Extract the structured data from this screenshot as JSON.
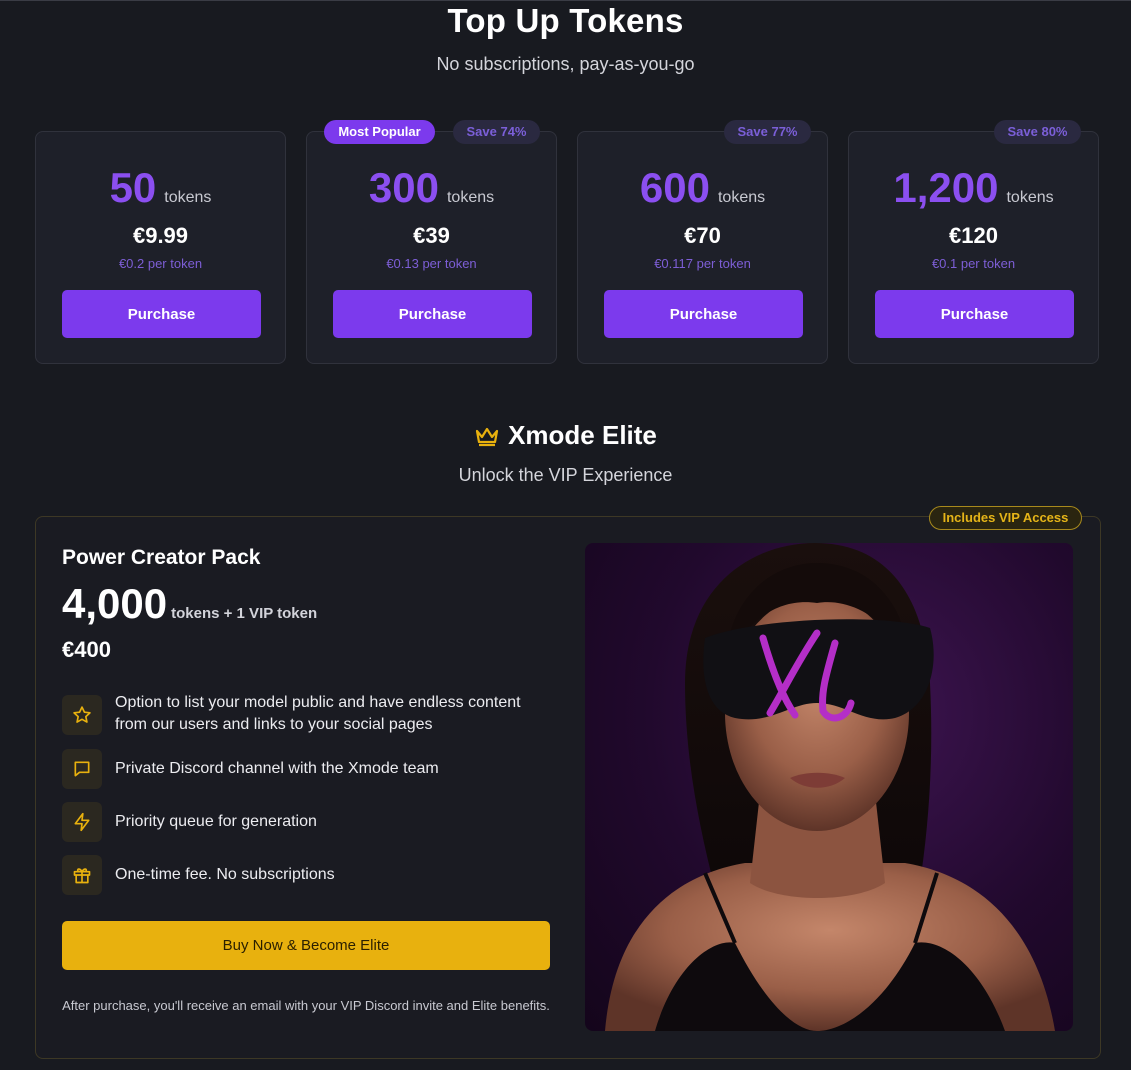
{
  "tokens_section": {
    "title": "Top Up Tokens",
    "subtitle": "No subscriptions, pay-as-you-go",
    "most_popular_label": "Most Popular",
    "packages": [
      {
        "amount": "50",
        "unit": "tokens",
        "price": "€9.99",
        "per_token": "€0.2 per token",
        "save": "",
        "button": "Purchase"
      },
      {
        "amount": "300",
        "unit": "tokens",
        "price": "€39",
        "per_token": "€0.13 per token",
        "save": "Save 74%",
        "button": "Purchase"
      },
      {
        "amount": "600",
        "unit": "tokens",
        "price": "€70",
        "per_token": "€0.117 per token",
        "save": "Save 77%",
        "button": "Purchase"
      },
      {
        "amount": "1,200",
        "unit": "tokens",
        "price": "€120",
        "per_token": "€0.1 per token",
        "save": "Save 80%",
        "button": "Purchase"
      }
    ]
  },
  "elite_section": {
    "title": "Xmode Elite",
    "subtitle": "Unlock the VIP Experience",
    "icon": "crown-icon",
    "accent_color": "#e8b10e",
    "badge": "Includes VIP Access",
    "pack_title": "Power Creator Pack",
    "pack_amount": "4,000",
    "pack_extra": "tokens + 1 VIP token",
    "pack_price": "€400",
    "features": [
      {
        "icon": "star-icon",
        "text": "Option to list your model public and have endless content from our users and links to your social pages"
      },
      {
        "icon": "message-square-icon",
        "text": "Private Discord channel with the Xmode team"
      },
      {
        "icon": "lightning-icon",
        "text": "Priority queue for generation"
      },
      {
        "icon": "gift-icon",
        "text": "One-time fee. No subscriptions"
      }
    ],
    "buy_button": "Buy Now & Become Elite",
    "after_note": "After purchase, you'll receive an email with your VIP Discord invite and Elite benefits."
  },
  "colors": {
    "background": "#181a20",
    "primary": "#7c3aed",
    "token_amount": "#8b4ff0"
  }
}
